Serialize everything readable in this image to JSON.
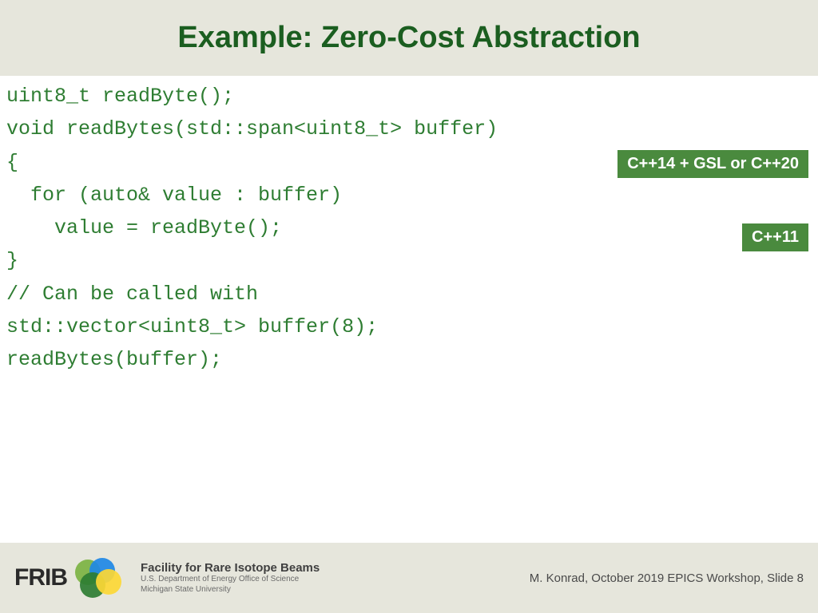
{
  "title": "Example: Zero-Cost Abstraction",
  "code": {
    "l1": "uint8_t readByte();",
    "l2": "",
    "l3": "void readBytes(std::span<uint8_t> buffer)",
    "l4": "{",
    "l5": "  for (auto& value : buffer)",
    "l6": "    value = readByte();",
    "l7": "}",
    "l8": "",
    "l9": "// Can be called with",
    "l10": "std::vector<uint8_t> buffer(8);",
    "l11": "readBytes(buffer);"
  },
  "badges": {
    "span_feature": "C++14 + GSL or C++20",
    "range_for": "C++11"
  },
  "footer": {
    "logo_text": "FRIB",
    "facility_title": "Facility for Rare Isotope Beams",
    "facility_sub1": "U.S. Department of Energy Office of Science",
    "facility_sub2": "Michigan State University",
    "attribution": "M. Konrad, October 2019 EPICS Workshop, Slide 8"
  }
}
